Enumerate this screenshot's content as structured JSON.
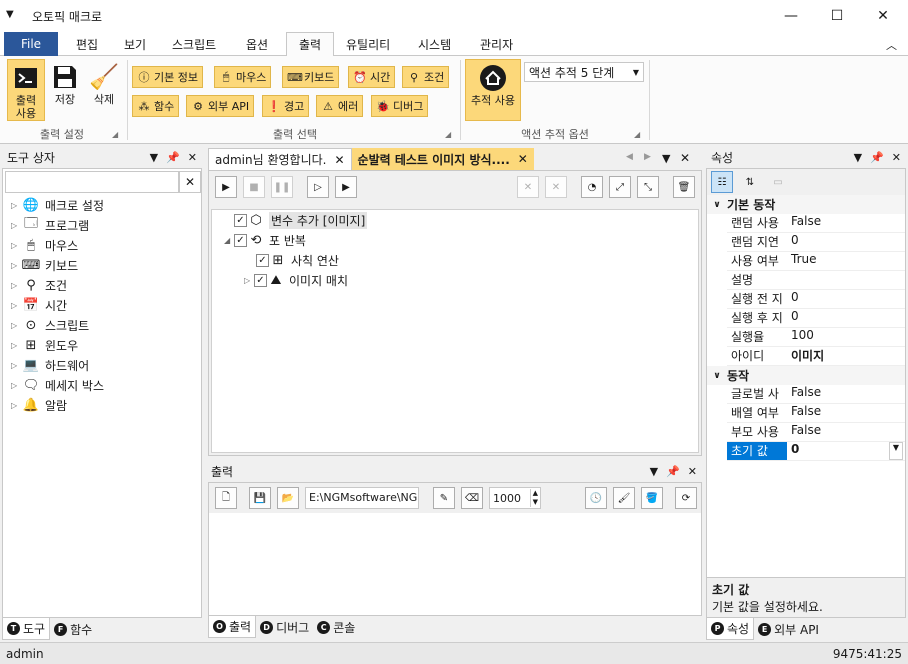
{
  "window": {
    "title": "오토픽 매크로",
    "app_icon": "menu-triangle-icon"
  },
  "tabs": {
    "file": "File",
    "items": [
      "편집",
      "보기",
      "스크립트",
      "옵션",
      "출력",
      "유틸리티",
      "시스템",
      "관리자"
    ],
    "active": "출력"
  },
  "ribbon": {
    "output_settings": {
      "label": "출력 설정",
      "output_use": "출력\n사용",
      "save": "저장",
      "delete": "삭제"
    },
    "output_select": {
      "label": "출력 선택",
      "row1": [
        "기본 정보",
        "마우스",
        "키보드",
        "시간",
        "조건"
      ],
      "row2": [
        "함수",
        "외부 API",
        "경고",
        "에러",
        "디버그"
      ]
    },
    "action_trace": {
      "label": "액션 추적 옵션",
      "trace_use": "추적 사용",
      "level_value": "액션 추적 5 단계"
    }
  },
  "toolbox": {
    "title": "도구 상자",
    "search_value": "",
    "items": [
      "매크로 설정",
      "프로그램",
      "마우스",
      "키보드",
      "조건",
      "시간",
      "스크립트",
      "윈도우",
      "하드웨어",
      "메세지 박스",
      "알람"
    ],
    "bottom_tabs": [
      "도구",
      "함수"
    ]
  },
  "editor": {
    "tabs": [
      "admin님 환영합니다.",
      "순발력 테스트 이미지 방식...."
    ],
    "tree": {
      "node1": "변수 추가 [이미지]",
      "node2": "포 반복",
      "node3": "사칙 연산",
      "node4": "이미지 매치"
    }
  },
  "output": {
    "title": "출력",
    "path_value": "E:\\NGMsoftware\\NG",
    "number_value": "1000",
    "bottom_tabs": [
      "출력",
      "디버그",
      "콘솔"
    ]
  },
  "properties": {
    "title": "속성",
    "cat1": "기본 동작",
    "rows1": [
      {
        "k": "랜덤 사용",
        "v": "False"
      },
      {
        "k": "랜덤 지연",
        "v": "0"
      },
      {
        "k": "사용 여부",
        "v": "True"
      },
      {
        "k": "설명",
        "v": ""
      },
      {
        "k": "실행 전 지",
        "v": "0"
      },
      {
        "k": "실행 후 지",
        "v": "0"
      },
      {
        "k": "실행율",
        "v": "100"
      },
      {
        "k": "아이디",
        "v": "이미지"
      }
    ],
    "cat2": "동작",
    "rows2": [
      {
        "k": "글로벌 사",
        "v": "False"
      },
      {
        "k": "배열 여부",
        "v": "False"
      },
      {
        "k": "부모 사용",
        "v": "False"
      },
      {
        "k": "초기 값",
        "v": "0"
      }
    ],
    "desc_title": "초기 값",
    "desc_text": "기본 값을 설정하세요.",
    "bottom_tabs": [
      "속성",
      "외부 API"
    ]
  },
  "status": {
    "user": "admin",
    "time": "9475:41:25"
  },
  "colors": {
    "accent": "#fcd87a",
    "file_tab": "#2b579a",
    "selected": "#0078d7"
  }
}
